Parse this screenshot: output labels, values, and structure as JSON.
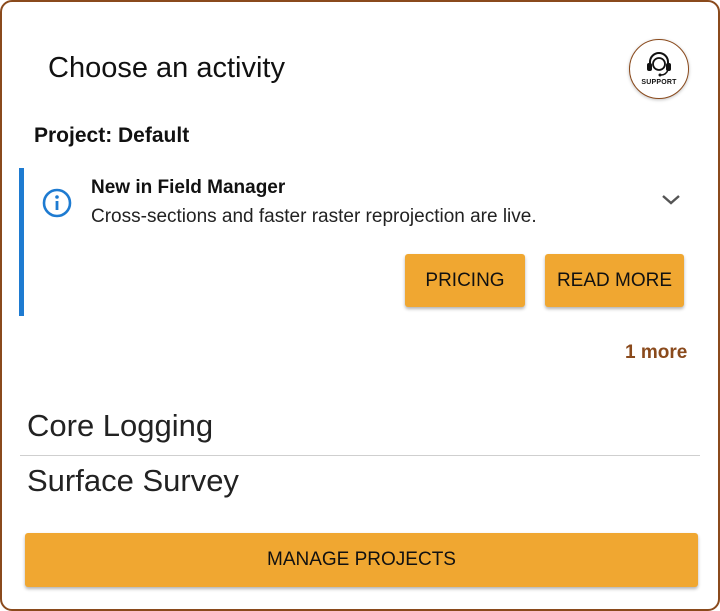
{
  "dialog": {
    "title": "Choose an activity",
    "support": {
      "label": "SUPPORT",
      "icon": "headset-icon"
    },
    "project_label": "Project: Default"
  },
  "banner": {
    "accent_color": "#1e7bd1",
    "icon": "info-icon",
    "heading": "New in Field Manager",
    "body": "Cross-sections and faster raster reprojection are live.",
    "buttons": {
      "pricing": "PRICING",
      "read_more": "READ MORE"
    },
    "more_link": "1 more"
  },
  "activities": [
    {
      "label": "Core Logging"
    },
    {
      "label": "Surface Survey"
    }
  ],
  "footer": {
    "manage_label": "MANAGE PROJECTS"
  },
  "colors": {
    "button": "#f0a731",
    "brand": "#8a4a1c"
  }
}
